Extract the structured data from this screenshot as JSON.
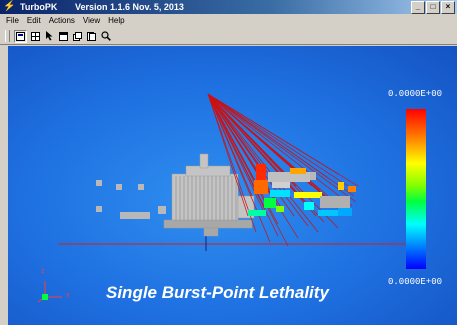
{
  "window": {
    "app_name": "TurboPK",
    "version": "Version 1.1.6  Nov. 5, 2013",
    "controls": {
      "minimize": "_",
      "maximize": "□",
      "close": "×"
    }
  },
  "menu": [
    "File",
    "Edit",
    "Actions",
    "View",
    "Help"
  ],
  "toolbar": {
    "buttons": [
      {
        "icon": "view-select-icon",
        "pressed": true
      },
      {
        "icon": "grid-icon",
        "pressed": false
      },
      {
        "icon": "pointer-icon",
        "pressed": false
      },
      {
        "icon": "window-icon",
        "pressed": false
      },
      {
        "icon": "copy-icon",
        "pressed": false
      },
      {
        "icon": "pages-icon",
        "pressed": false
      },
      {
        "icon": "zoom-icon",
        "pressed": false
      }
    ]
  },
  "viewport": {
    "background_color": "#1e6fe0",
    "caption": "Single Burst-Point Lethality",
    "axis_triad": {
      "z": "z",
      "x": "x"
    },
    "colorbar": {
      "top_label": "0.0000E+00",
      "bottom_label": "0.0000E+00",
      "colors": [
        "#ff0000",
        "#ff8000",
        "#ffff00",
        "#80ff00",
        "#00ff40",
        "#00ffff",
        "#0080ff",
        "#0000ff"
      ]
    },
    "ray_color": "#cc1111",
    "model_color": "#c0c0c0"
  }
}
